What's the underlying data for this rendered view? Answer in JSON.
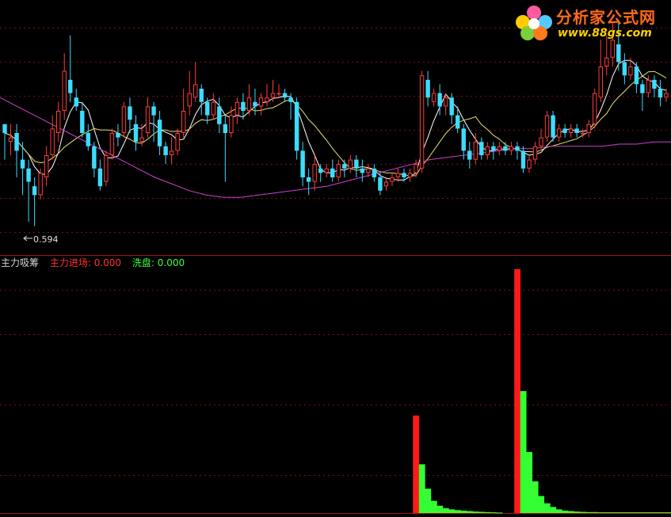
{
  "brand": {
    "name": "分析家公式网",
    "url": "www.88gs.com"
  },
  "colors": {
    "background": "#000000",
    "grid": "#7a1010",
    "up": "#ff3c3c",
    "down": "#3cdcff",
    "ma_fast": "#ffffff",
    "ma_mid": "#e8e06a",
    "ma_slow": "#d040d0",
    "indicator_red": "#ff1a1a",
    "indicator_green": "#33ff33"
  },
  "main_panel": {
    "low_marker": "0.594"
  },
  "indicator_panel": {
    "title": "主力吸筹",
    "series": [
      {
        "name": "主力进场",
        "label": "主力进场: 0.000",
        "color": "#ff1a1a"
      },
      {
        "name": "洗盘",
        "label": "洗盘: 0.000",
        "color": "#33ff33"
      }
    ]
  },
  "chart_data": [
    {
      "type": "candlestick",
      "price_range": [
        0.55,
        1.05
      ],
      "candles": [
        [
          0.82,
          0.8,
          0.82,
          0.74
        ],
        [
          0.78,
          0.79,
          0.82,
          0.75
        ],
        [
          0.8,
          0.76,
          0.82,
          0.7
        ],
        [
          0.74,
          0.72,
          0.78,
          0.66
        ],
        [
          0.72,
          0.69,
          0.74,
          0.6
        ],
        [
          0.68,
          0.66,
          0.7,
          0.59
        ],
        [
          0.66,
          0.71,
          0.72,
          0.65
        ],
        [
          0.7,
          0.75,
          0.77,
          0.68
        ],
        [
          0.75,
          0.81,
          0.84,
          0.74
        ],
        [
          0.8,
          0.85,
          0.87,
          0.78
        ],
        [
          0.85,
          0.94,
          0.98,
          0.83
        ],
        [
          0.92,
          0.89,
          1.02,
          0.87
        ],
        [
          0.88,
          0.86,
          0.9,
          0.85
        ],
        [
          0.85,
          0.8,
          0.87,
          0.79
        ],
        [
          0.8,
          0.77,
          0.82,
          0.76
        ],
        [
          0.77,
          0.72,
          0.78,
          0.7
        ],
        [
          0.72,
          0.68,
          0.74,
          0.67
        ],
        [
          0.69,
          0.75,
          0.76,
          0.68
        ],
        [
          0.75,
          0.8,
          0.81,
          0.74
        ],
        [
          0.8,
          0.79,
          0.82,
          0.77
        ],
        [
          0.8,
          0.86,
          0.87,
          0.79
        ],
        [
          0.86,
          0.83,
          0.88,
          0.8
        ],
        [
          0.82,
          0.78,
          0.84,
          0.76
        ],
        [
          0.78,
          0.79,
          0.82,
          0.77
        ],
        [
          0.8,
          0.86,
          0.88,
          0.79
        ],
        [
          0.86,
          0.84,
          0.87,
          0.78
        ],
        [
          0.83,
          0.77,
          0.85,
          0.75
        ],
        [
          0.77,
          0.75,
          0.78,
          0.73
        ],
        [
          0.75,
          0.76,
          0.79,
          0.73
        ],
        [
          0.76,
          0.8,
          0.81,
          0.75
        ],
        [
          0.8,
          0.85,
          0.9,
          0.79
        ],
        [
          0.86,
          0.89,
          0.94,
          0.84
        ],
        [
          0.88,
          0.91,
          0.96,
          0.87
        ],
        [
          0.9,
          0.87,
          0.91,
          0.84
        ],
        [
          0.87,
          0.84,
          0.88,
          0.82
        ],
        [
          0.84,
          0.87,
          0.89,
          0.83
        ],
        [
          0.86,
          0.82,
          0.88,
          0.8
        ],
        [
          0.82,
          0.8,
          0.84,
          0.69
        ],
        [
          0.8,
          0.84,
          0.86,
          0.79
        ],
        [
          0.84,
          0.87,
          0.88,
          0.82
        ],
        [
          0.87,
          0.85,
          0.89,
          0.83
        ],
        [
          0.85,
          0.88,
          0.91,
          0.84
        ],
        [
          0.87,
          0.86,
          0.9,
          0.84
        ],
        [
          0.86,
          0.88,
          0.89,
          0.84
        ],
        [
          0.87,
          0.88,
          0.91,
          0.86
        ],
        [
          0.88,
          0.89,
          0.92,
          0.87
        ],
        [
          0.89,
          0.89,
          0.91,
          0.88
        ],
        [
          0.89,
          0.88,
          0.9,
          0.87
        ],
        [
          0.88,
          0.87,
          0.89,
          0.83
        ],
        [
          0.87,
          0.76,
          0.88,
          0.74
        ],
        [
          0.76,
          0.7,
          0.78,
          0.68
        ],
        [
          0.7,
          0.69,
          0.72,
          0.66
        ],
        [
          0.69,
          0.73,
          0.75,
          0.67
        ],
        [
          0.72,
          0.71,
          0.73,
          0.69
        ],
        [
          0.71,
          0.72,
          0.73,
          0.7
        ],
        [
          0.72,
          0.7,
          0.74,
          0.69
        ],
        [
          0.7,
          0.73,
          0.74,
          0.69
        ],
        [
          0.73,
          0.72,
          0.74,
          0.7
        ],
        [
          0.72,
          0.74,
          0.75,
          0.71
        ],
        [
          0.74,
          0.72,
          0.75,
          0.7
        ],
        [
          0.72,
          0.71,
          0.74,
          0.69
        ],
        [
          0.71,
          0.72,
          0.73,
          0.7
        ],
        [
          0.72,
          0.7,
          0.73,
          0.69
        ],
        [
          0.7,
          0.67,
          0.71,
          0.66
        ],
        [
          0.68,
          0.69,
          0.7,
          0.67
        ],
        [
          0.69,
          0.7,
          0.71,
          0.68
        ],
        [
          0.7,
          0.71,
          0.72,
          0.69
        ],
        [
          0.71,
          0.7,
          0.72,
          0.69
        ],
        [
          0.7,
          0.71,
          0.72,
          0.69
        ],
        [
          0.71,
          0.73,
          0.74,
          0.7
        ],
        [
          0.72,
          0.93,
          0.94,
          0.71
        ],
        [
          0.92,
          0.88,
          0.94,
          0.86
        ],
        [
          0.87,
          0.89,
          0.9,
          0.86
        ],
        [
          0.89,
          0.86,
          0.91,
          0.84
        ],
        [
          0.86,
          0.88,
          0.89,
          0.84
        ],
        [
          0.88,
          0.84,
          0.89,
          0.82
        ],
        [
          0.84,
          0.81,
          0.86,
          0.8
        ],
        [
          0.81,
          0.76,
          0.82,
          0.74
        ],
        [
          0.76,
          0.74,
          0.78,
          0.72
        ],
        [
          0.74,
          0.78,
          0.8,
          0.73
        ],
        [
          0.78,
          0.75,
          0.79,
          0.74
        ],
        [
          0.75,
          0.77,
          0.78,
          0.74
        ],
        [
          0.77,
          0.76,
          0.78,
          0.74
        ],
        [
          0.76,
          0.77,
          0.78,
          0.75
        ],
        [
          0.77,
          0.76,
          0.78,
          0.75
        ],
        [
          0.76,
          0.77,
          0.78,
          0.75
        ],
        [
          0.77,
          0.76,
          0.78,
          0.74
        ],
        [
          0.76,
          0.72,
          0.77,
          0.71
        ],
        [
          0.72,
          0.74,
          0.75,
          0.71
        ],
        [
          0.74,
          0.77,
          0.78,
          0.73
        ],
        [
          0.77,
          0.79,
          0.81,
          0.76
        ],
        [
          0.79,
          0.84,
          0.85,
          0.78
        ],
        [
          0.84,
          0.79,
          0.85,
          0.78
        ],
        [
          0.79,
          0.81,
          0.82,
          0.78
        ],
        [
          0.81,
          0.8,
          0.82,
          0.79
        ],
        [
          0.8,
          0.81,
          0.82,
          0.79
        ],
        [
          0.81,
          0.8,
          0.82,
          0.79
        ],
        [
          0.8,
          0.8,
          0.81,
          0.79
        ],
        [
          0.8,
          0.82,
          0.83,
          0.79
        ],
        [
          0.82,
          0.89,
          0.9,
          0.81
        ],
        [
          0.88,
          0.95,
          1.01,
          0.87
        ],
        [
          0.95,
          0.97,
          1.02,
          0.93
        ],
        [
          0.97,
          1.01,
          1.05,
          0.95
        ],
        [
          1.0,
          0.96,
          1.05,
          0.94
        ],
        [
          0.96,
          0.93,
          0.98,
          0.91
        ],
        [
          0.93,
          0.95,
          0.97,
          0.92
        ],
        [
          0.95,
          0.91,
          0.96,
          0.89
        ],
        [
          0.91,
          0.89,
          0.92,
          0.85
        ],
        [
          0.89,
          0.92,
          0.93,
          0.88
        ],
        [
          0.92,
          0.9,
          0.93,
          0.88
        ],
        [
          0.9,
          0.88,
          0.92,
          0.86
        ],
        [
          0.88,
          0.89,
          0.9,
          0.87
        ]
      ],
      "moving_averages": [
        {
          "color": "#ffffff",
          "period": 5
        },
        {
          "color": "#e8e06a",
          "period": 10
        },
        {
          "color": "#d040d0",
          "values": [
            0.88,
            0.86,
            0.84,
            0.82,
            0.8,
            0.78,
            0.76,
            0.74,
            0.72,
            0.7,
            0.685,
            0.67,
            0.66,
            0.655,
            0.655,
            0.66,
            0.665,
            0.67,
            0.675,
            0.68,
            0.69,
            0.7,
            0.71,
            0.72,
            0.73,
            0.74,
            0.745,
            0.75,
            0.755,
            0.76,
            0.765,
            0.765,
            0.77,
            0.77,
            0.77,
            0.77,
            0.775,
            0.775,
            0.78,
            0.78
          ]
        }
      ]
    },
    {
      "type": "bar",
      "ylim": [
        0,
        1
      ],
      "series": [
        {
          "name": "主力进场",
          "color": "#ff1a1a",
          "x": [
            69,
            86
          ],
          "values": [
            0.4,
            1.0
          ]
        },
        {
          "name": "洗盘",
          "color": "#33ff33",
          "x": [
            70,
            71,
            72,
            73,
            74,
            75,
            76,
            77,
            78,
            79,
            80,
            81,
            82,
            83,
            87,
            88,
            89,
            90,
            91,
            92,
            93,
            94,
            95,
            96,
            97,
            98,
            99,
            100,
            101,
            102,
            103,
            104,
            105,
            106,
            107,
            108,
            109,
            110,
            111,
            112,
            113,
            114,
            115,
            116,
            117,
            118,
            119,
            120
          ],
          "values": [
            0.2,
            0.1,
            0.05,
            0.03,
            0.02,
            0.015,
            0.012,
            0.01,
            0.008,
            0.006,
            0.005,
            0.004,
            0.003,
            0.002,
            0.5,
            0.25,
            0.13,
            0.07,
            0.04,
            0.025,
            0.015,
            0.01,
            0.008,
            0.006,
            0.005,
            0.004,
            0.004,
            0.003,
            0.003,
            0.003,
            0.003,
            0.003,
            0.003,
            0.003,
            0.003,
            0.003,
            0.003,
            0.003,
            0.003,
            0.003,
            0.003,
            0.003,
            0.003,
            0.003,
            0.003,
            0.003,
            0.003,
            0.003
          ]
        }
      ]
    }
  ]
}
